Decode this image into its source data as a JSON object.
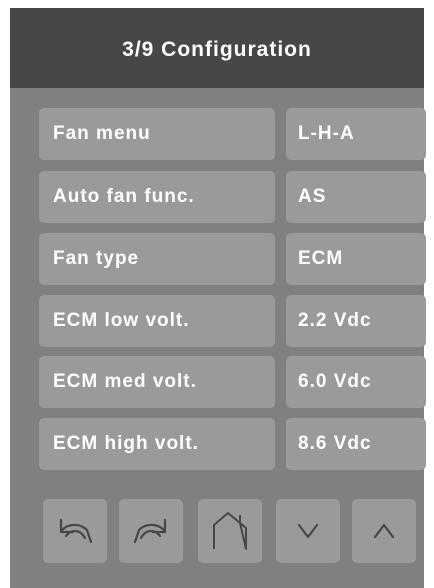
{
  "header": {
    "title": "3/9 Configuration"
  },
  "settings": [
    {
      "label": "Fan menu",
      "value": "L-H-A"
    },
    {
      "label": "Auto fan func.",
      "value": "AS"
    },
    {
      "label": "Fan type",
      "value": "ECM"
    },
    {
      "label": "ECM low volt.",
      "value": "2.2 Vdc"
    },
    {
      "label": "ECM med volt.",
      "value": "6.0 Vdc"
    },
    {
      "label": "ECM high volt.",
      "value": "8.6 Vdc"
    }
  ],
  "nav_buttons": [
    {
      "icon": "undo-icon"
    },
    {
      "icon": "redo-icon"
    },
    {
      "icon": "home-icon"
    },
    {
      "icon": "chevron-down-icon"
    },
    {
      "icon": "chevron-up-icon"
    }
  ],
  "colors": {
    "background": "#808080",
    "header": "#474747",
    "button": "#9a9a9a",
    "text": "#ffffff",
    "icon": "#474747"
  }
}
